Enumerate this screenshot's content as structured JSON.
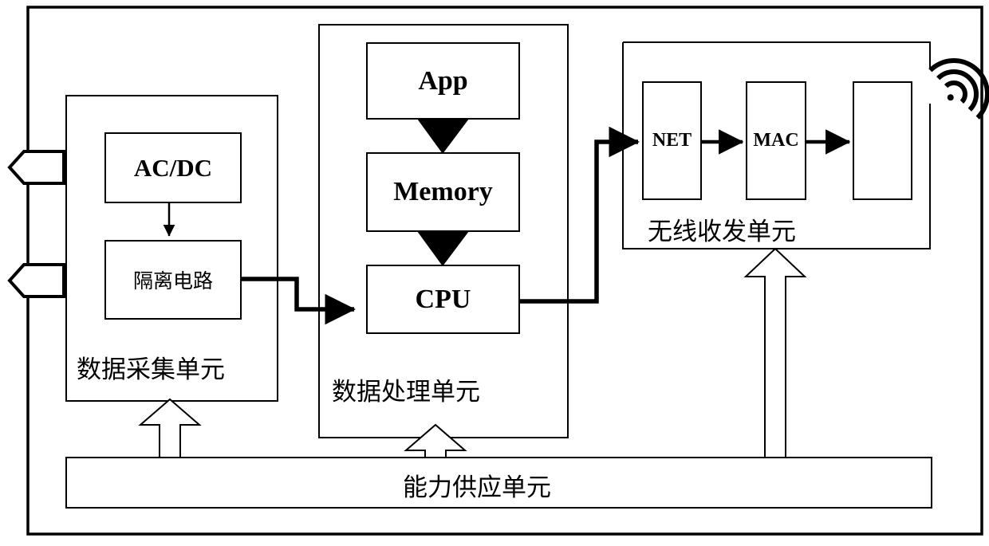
{
  "diagram": {
    "title": "Wireless data acquisition device block diagram",
    "stroke_color": "#000000",
    "background_color": "#ffffff"
  },
  "outer_frame": {
    "name": "device-outer-frame"
  },
  "external_ports": [
    {
      "id": "port-top",
      "label": ""
    },
    {
      "id": "port-bottom",
      "label": ""
    }
  ],
  "units": [
    {
      "id": "data-acquisition-unit",
      "label": "数据采集单元",
      "blocks": [
        {
          "id": "acdc",
          "label": "AC/DC",
          "script": "latin"
        },
        {
          "id": "isolation-circuit",
          "label": "隔离电路",
          "script": "cjk"
        }
      ]
    },
    {
      "id": "data-processing-unit",
      "label": "数据处理单元",
      "blocks": [
        {
          "id": "app",
          "label": "App",
          "script": "latin"
        },
        {
          "id": "memory",
          "label": "Memory",
          "script": "latin"
        },
        {
          "id": "cpu",
          "label": "CPU",
          "script": "latin"
        }
      ]
    },
    {
      "id": "wireless-transceiver-unit",
      "label": "无线收发单元",
      "blocks": [
        {
          "id": "net",
          "label": "NET",
          "script": "latin"
        },
        {
          "id": "mac",
          "label": "MAC",
          "script": "latin"
        },
        {
          "id": "rf-front-end",
          "label": "",
          "script": "latin"
        }
      ]
    },
    {
      "id": "power-supply-unit",
      "label": "能力供应单元",
      "blocks": []
    }
  ],
  "icons": [
    {
      "id": "wifi-signal-icon",
      "name": "wifi-icon",
      "arcs": 3
    }
  ],
  "connections": [
    {
      "from": "acdc",
      "to": "isolation-circuit",
      "style": "filled-arrow"
    },
    {
      "from": "isolation-circuit",
      "to": "cpu",
      "style": "thick-stepped-arrow"
    },
    {
      "from": "app",
      "to": "memory",
      "style": "solid-wedge"
    },
    {
      "from": "memory",
      "to": "cpu",
      "style": "solid-wedge"
    },
    {
      "from": "cpu",
      "to": "net",
      "style": "thick-stepped-arrow"
    },
    {
      "from": "net",
      "to": "mac",
      "style": "filled-arrow"
    },
    {
      "from": "mac",
      "to": "rf-front-end",
      "style": "filled-arrow"
    },
    {
      "from": "power-supply-unit",
      "to": "data-acquisition-unit",
      "style": "hollow-block-arrow"
    },
    {
      "from": "power-supply-unit",
      "to": "data-processing-unit",
      "style": "hollow-block-arrow"
    },
    {
      "from": "power-supply-unit",
      "to": "wireless-transceiver-unit",
      "style": "hollow-block-arrow"
    }
  ]
}
